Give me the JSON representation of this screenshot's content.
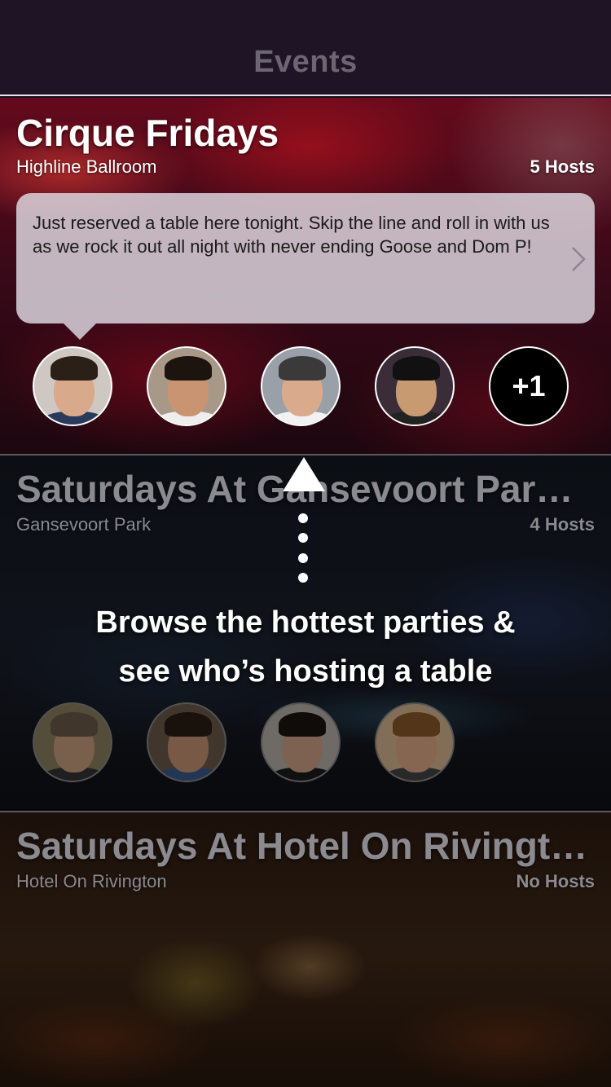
{
  "nav": {
    "title": "Events"
  },
  "events": [
    {
      "title": "Cirque Fridays",
      "venue": "Highline Ballroom",
      "hosts_label": "5 Hosts",
      "message": "Just reserved a table here tonight. Skip the line and roll in with us as we rock it out all night with never ending Goose and Dom P!",
      "more_hosts": "+1"
    },
    {
      "title": "Saturdays At Gansevoort Park...",
      "venue": "Gansevoort Park",
      "hosts_label": "4 Hosts"
    },
    {
      "title": "Saturdays At Hotel On Rivington",
      "venue": "Hotel On Rivington",
      "hosts_label": "No Hosts"
    }
  ],
  "tooltip": {
    "line1": "Browse the hottest parties &",
    "line2": "see who’s hosting a table"
  },
  "colors": {
    "navbar": "#1f1426",
    "nav_title": "#6b6670",
    "bubble": "#e1dce4"
  }
}
